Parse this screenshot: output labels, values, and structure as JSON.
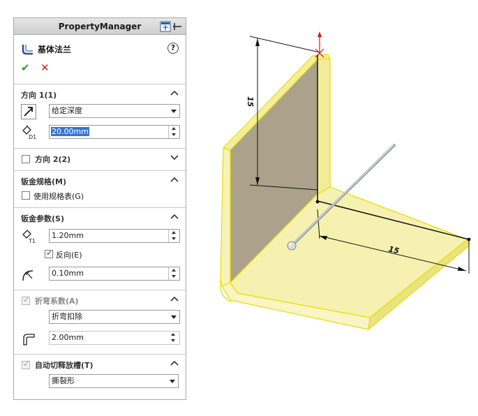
{
  "panel": {
    "title": "PropertyManager",
    "feature_title": "基体法兰",
    "help_label": "?",
    "ok_label": "✔",
    "cancel_label": "✕"
  },
  "direction1": {
    "title": "方向 1(1)",
    "end_condition": "给定深度",
    "depth": "20.00mm"
  },
  "direction2": {
    "title": "方向 2(2)",
    "checked": false
  },
  "gauge": {
    "title": "钣金规格(M)",
    "use_table_label": "使用规格表(G)",
    "use_table_checked": false
  },
  "sheet_params": {
    "title": "钣金参数(S)",
    "thickness": "1.20mm",
    "reverse_label": "反向(E)",
    "reverse_checked": true,
    "bend_radius": "0.10mm"
  },
  "bend_allowance": {
    "title": "折弯系数(A)",
    "checked": true,
    "type": "折弯扣除",
    "value": "2.00mm"
  },
  "auto_relief": {
    "title": "自动切释放槽(T)",
    "checked": true,
    "type": "撕裂形"
  },
  "viewport": {
    "dim_vertical": "15",
    "dim_horizontal": "15",
    "part_color": "#f5f0a6",
    "edge_color": "#e8e000",
    "wall_color": "#aaa28a"
  }
}
